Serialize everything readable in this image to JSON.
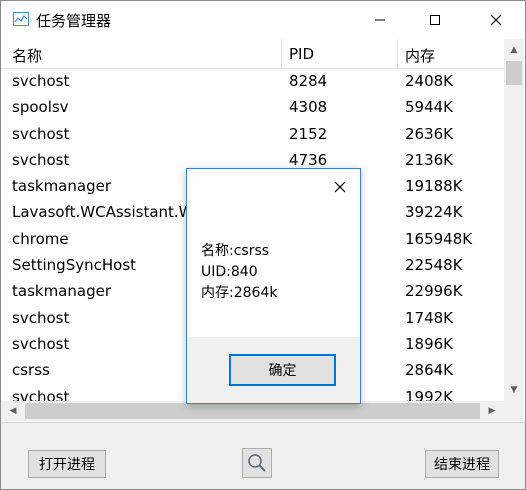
{
  "window": {
    "title": "任务管理器",
    "icon": "chart-line-icon"
  },
  "columns": [
    "名称",
    "PID",
    "内存"
  ],
  "processes": [
    {
      "name": "svchost",
      "pid": "8284",
      "memory": "2408K"
    },
    {
      "name": "spoolsv",
      "pid": "4308",
      "memory": "5944K"
    },
    {
      "name": "svchost",
      "pid": "2152",
      "memory": "2636K"
    },
    {
      "name": "svchost",
      "pid": "4736",
      "memory": "2136K"
    },
    {
      "name": "taskmanager",
      "pid": "",
      "memory": "19188K"
    },
    {
      "name": "Lavasoft.WCAssistant.WinService",
      "pid": "",
      "memory": "39224K"
    },
    {
      "name": "chrome",
      "pid": "",
      "memory": "165948K"
    },
    {
      "name": "SettingSyncHost",
      "pid": "",
      "memory": "22548K"
    },
    {
      "name": "taskmanager",
      "pid": "",
      "memory": "22996K"
    },
    {
      "name": "svchost",
      "pid": "",
      "memory": "1748K"
    },
    {
      "name": "svchost",
      "pid": "",
      "memory": "1896K"
    },
    {
      "name": "csrss",
      "pid": "",
      "memory": "2864K"
    },
    {
      "name": "svchost",
      "pid": "",
      "memory": "1992K"
    }
  ],
  "buttons": {
    "open": "打开进程",
    "end": "结束进程",
    "search_icon": "magnifier-icon"
  },
  "dialog": {
    "line1": "名称:csrss",
    "line2": "UID:840",
    "line3": "内存:2864k",
    "ok": "确定"
  }
}
